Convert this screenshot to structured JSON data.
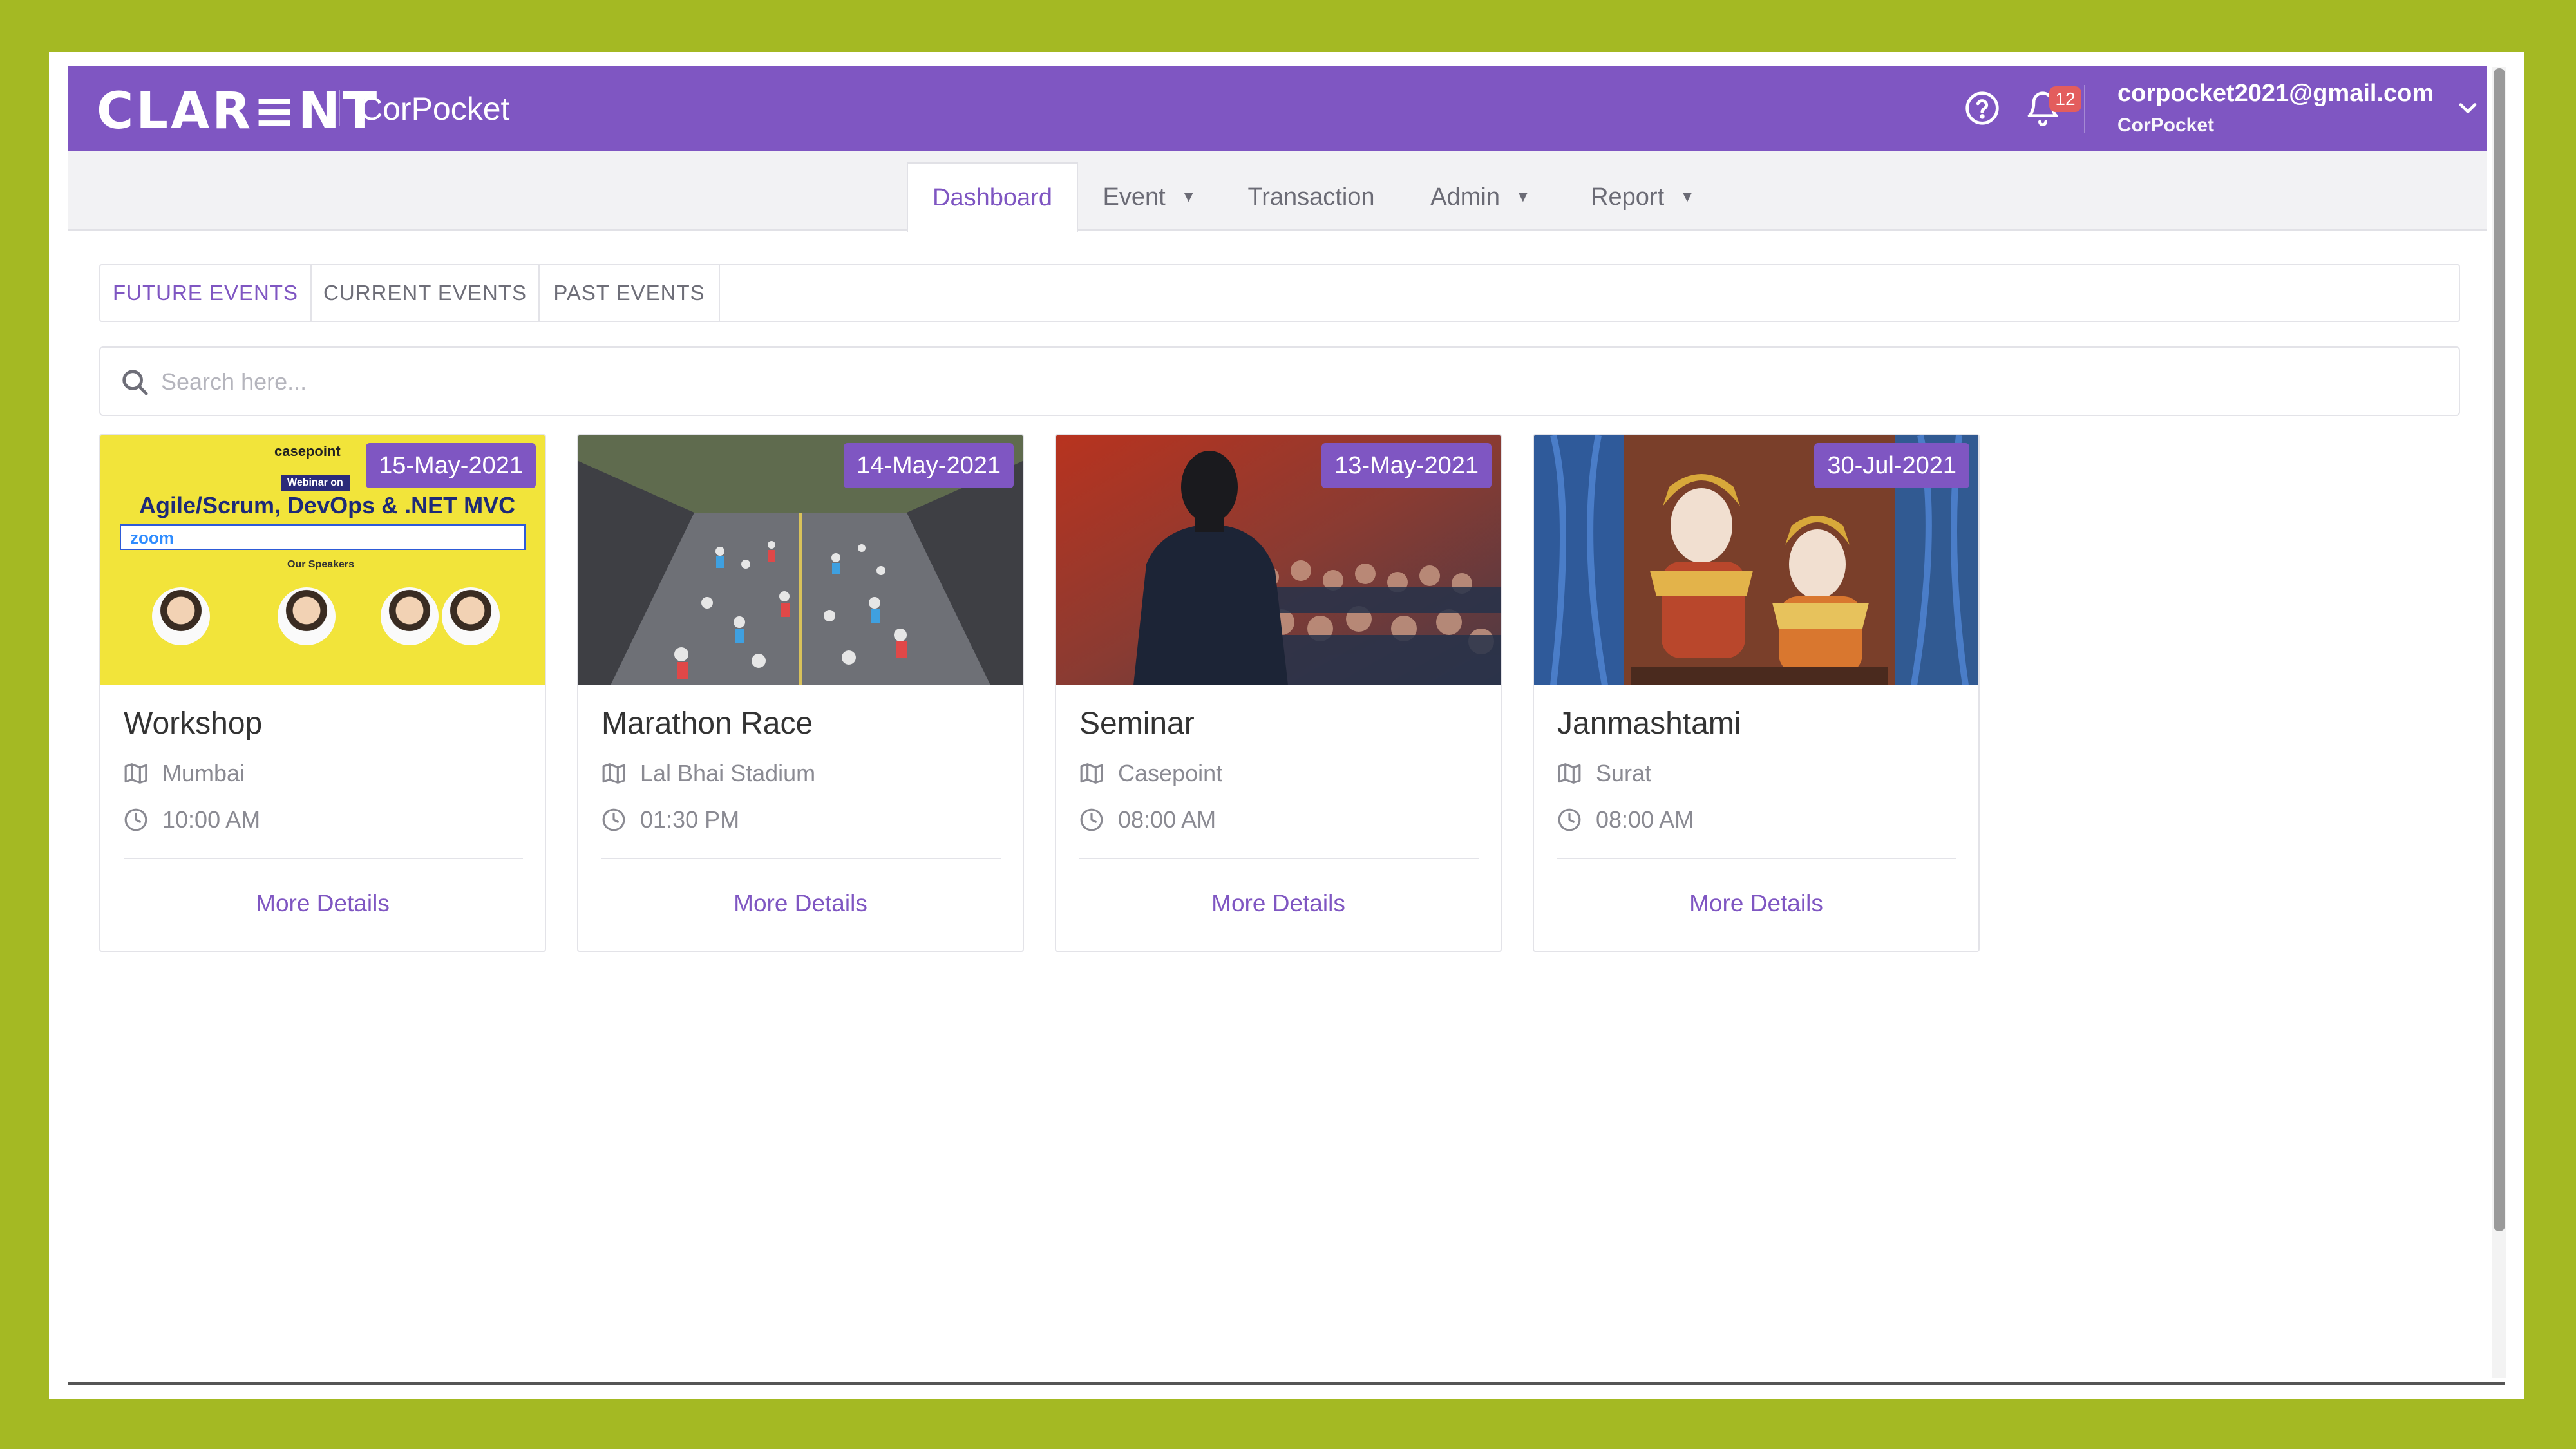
{
  "header": {
    "logo": "CLAR≡NT",
    "app_name": "CorPocket",
    "notification_count": "12",
    "user_email": "corpocket2021@gmail.com",
    "user_org": "CorPocket",
    "brand_color": "#7f56c2"
  },
  "nav": {
    "items": [
      {
        "label": "Dashboard",
        "active": true
      },
      {
        "label": "Event",
        "dropdown": true
      },
      {
        "label": "Transaction"
      },
      {
        "label": "Admin",
        "dropdown": true
      },
      {
        "label": "Report",
        "dropdown": true
      }
    ]
  },
  "tabs": [
    {
      "label": "FUTURE EVENTS",
      "active": true
    },
    {
      "label": "CURRENT EVENTS"
    },
    {
      "label": "PAST EVENTS"
    }
  ],
  "search": {
    "placeholder": "Search here...",
    "value": ""
  },
  "events": [
    {
      "date": "15-May-2021",
      "title": "Workshop",
      "location": "Mumbai",
      "time": "10:00 AM",
      "action": "More Details"
    },
    {
      "date": "14-May-2021",
      "title": "Marathon Race",
      "location": "Lal Bhai Stadium",
      "time": "01:30 PM",
      "action": "More Details"
    },
    {
      "date": "13-May-2021",
      "title": "Seminar",
      "location": "Casepoint",
      "time": "08:00 AM",
      "action": "More Details"
    },
    {
      "date": "30-Jul-2021",
      "title": "Janmashtami",
      "location": "Surat",
      "time": "08:00 AM",
      "action": "More Details"
    }
  ],
  "workshop_poster": {
    "brand": "casepoint",
    "webinar": "Webinar on",
    "headline": "Agile/Scrum, DevOps & .NET MVC",
    "zoom": "zoom",
    "speakers_heading": "Our Speakers"
  },
  "icons": {
    "help": "help-circle-icon",
    "bell": "bell-icon",
    "user_menu": "chevron-down-icon",
    "search": "search-icon",
    "location": "map-icon",
    "time": "clock-icon"
  }
}
